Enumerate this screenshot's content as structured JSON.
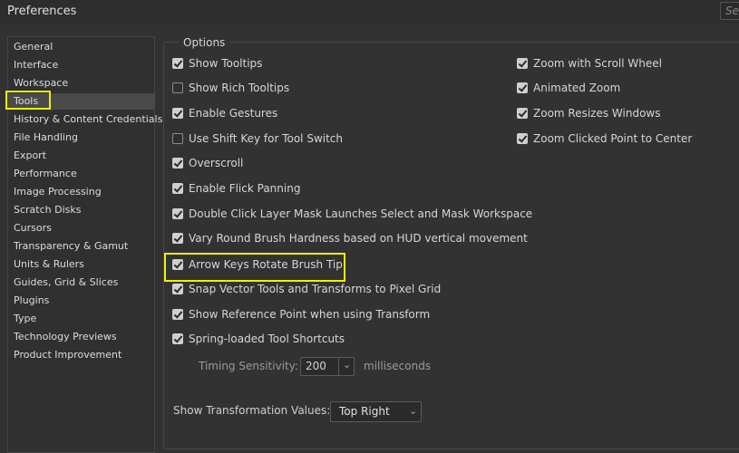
{
  "window": {
    "title": "Preferences",
    "search_placeholder": "Se"
  },
  "sidebar": {
    "items": [
      {
        "label": "General"
      },
      {
        "label": "Interface"
      },
      {
        "label": "Workspace"
      },
      {
        "label": "Tools",
        "selected": true
      },
      {
        "label": "History & Content Credentials"
      },
      {
        "label": "File Handling"
      },
      {
        "label": "Export"
      },
      {
        "label": "Performance"
      },
      {
        "label": "Image Processing"
      },
      {
        "label": "Scratch Disks"
      },
      {
        "label": "Cursors"
      },
      {
        "label": "Transparency & Gamut"
      },
      {
        "label": "Units & Rulers"
      },
      {
        "label": "Guides, Grid & Slices"
      },
      {
        "label": "Plugins"
      },
      {
        "label": "Type"
      },
      {
        "label": "Technology Previews"
      },
      {
        "label": "Product Improvement"
      }
    ]
  },
  "options": {
    "title": "Options",
    "left": [
      {
        "label": "Show Tooltips",
        "checked": true
      },
      {
        "label": "Show Rich Tooltips",
        "checked": false
      },
      {
        "label": "Enable Gestures",
        "checked": true
      },
      {
        "label": "Use Shift Key for Tool Switch",
        "checked": false
      },
      {
        "label": "Overscroll",
        "checked": true
      },
      {
        "label": "Enable Flick Panning",
        "checked": true
      },
      {
        "label": "Double Click Layer Mask Launches Select and Mask Workspace",
        "checked": true
      },
      {
        "label": "Vary Round Brush Hardness based on HUD vertical movement",
        "checked": true
      },
      {
        "label": "Arrow Keys Rotate Brush Tip",
        "checked": true
      },
      {
        "label": "Snap Vector Tools and Transforms to Pixel Grid",
        "checked": true
      },
      {
        "label": "Show Reference Point when using Transform",
        "checked": true
      },
      {
        "label": "Spring-loaded Tool Shortcuts",
        "checked": true
      }
    ],
    "right": [
      {
        "label": "Zoom with Scroll Wheel",
        "checked": true
      },
      {
        "label": "Animated Zoom",
        "checked": true
      },
      {
        "label": "Zoom Resizes Windows",
        "checked": true
      },
      {
        "label": "Zoom Clicked Point to Center",
        "checked": true
      }
    ],
    "timing": {
      "label": "Timing Sensitivity:",
      "value": "200",
      "unit": "milliseconds"
    },
    "transform_values": {
      "label": "Show Transformation Values:",
      "value": "Top Right"
    }
  },
  "colors": {
    "highlight": "#f1f000",
    "background": "#323232"
  }
}
